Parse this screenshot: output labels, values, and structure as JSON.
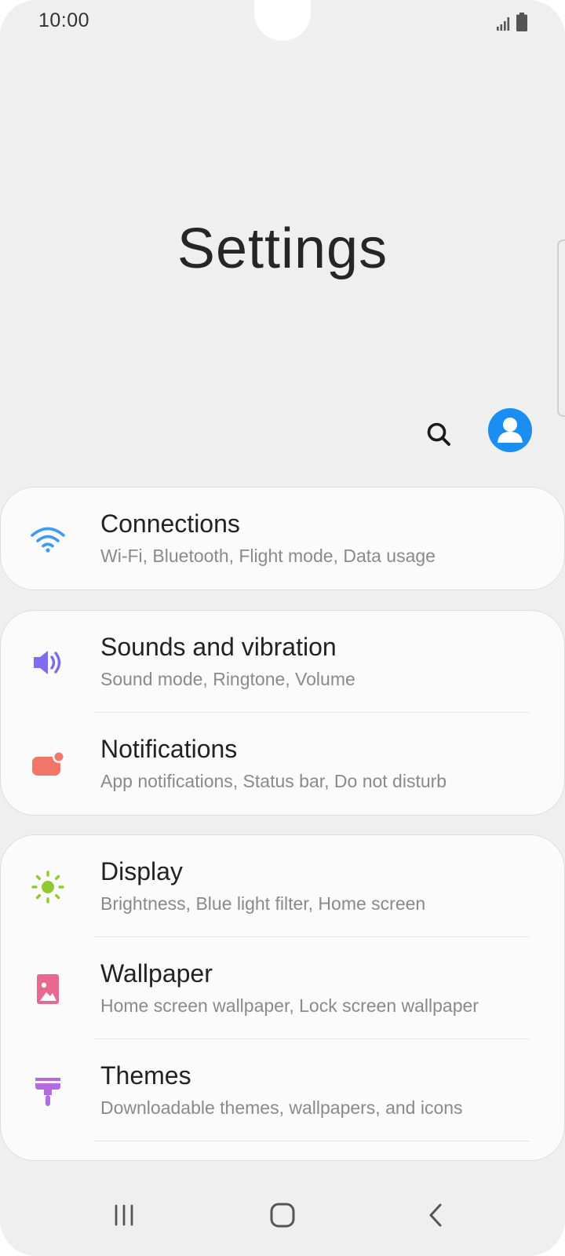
{
  "status_bar": {
    "time": "10:00",
    "icons": [
      "signal-icon",
      "battery-icon"
    ]
  },
  "header": {
    "title": "Settings",
    "icons": [
      "search-icon",
      "profile-icon"
    ]
  },
  "colors": {
    "background": "#efefef",
    "card": "#fbfbfb",
    "profile_accent": "#1b8ef2",
    "connections_icon": "#3d9bf2",
    "sounds_icon": "#7b6cf0",
    "notifications_icon": "#f2766a",
    "display_icon": "#8fcb2c",
    "wallpaper_icon": "#e8698f",
    "themes_icon": "#b46ae0"
  },
  "groups": [
    {
      "items": [
        {
          "icon": "wifi-icon",
          "title": "Connections",
          "subtitle": "Wi-Fi, Bluetooth, Flight mode, Data usage"
        }
      ]
    },
    {
      "items": [
        {
          "icon": "speaker-icon",
          "title": "Sounds and vibration",
          "subtitle": "Sound mode, Ringtone, Volume"
        },
        {
          "icon": "notification-icon",
          "title": "Notifications",
          "subtitle": "App notifications, Status bar, Do not disturb"
        }
      ]
    },
    {
      "items": [
        {
          "icon": "sun-icon",
          "title": "Display",
          "subtitle": "Brightness, Blue light filter, Home screen"
        },
        {
          "icon": "wallpaper-icon",
          "title": "Wallpaper",
          "subtitle": "Home screen wallpaper, Lock screen wallpaper"
        },
        {
          "icon": "paint-roller-icon",
          "title": "Themes",
          "subtitle": "Downloadable themes, wallpapers, and icons"
        }
      ]
    }
  ],
  "nav_bar": {
    "buttons": [
      "recents-icon",
      "home-icon",
      "back-icon"
    ]
  }
}
